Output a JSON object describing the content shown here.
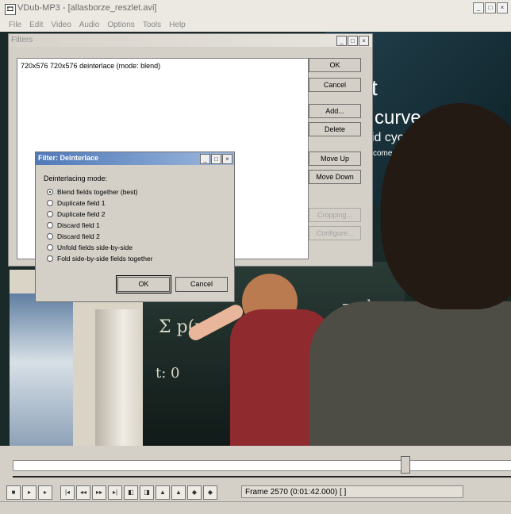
{
  "window": {
    "title": "VDub-MP3 - [allasborze_reszlet.avi]",
    "app_icon": "🎞",
    "controls": [
      "_",
      "□",
      "×"
    ]
  },
  "menu": [
    "File",
    "Edit",
    "Video",
    "Audio",
    "Options",
    "Tools",
    "Help"
  ],
  "video_overlay": {
    "slide_texts": [
      "t",
      "curve",
      "id cycle.",
      "come to life"
    ]
  },
  "filters_dialog": {
    "title": "Filters",
    "controls": [
      "_",
      "□",
      "×"
    ],
    "filter_item": "720x576 720x576 deinterlace (mode: blend)",
    "buttons": {
      "ok": "OK",
      "cancel": "Cancel",
      "add": "Add...",
      "delete": "Delete",
      "move_up": "Move Up",
      "move_down": "Move Down",
      "cropping": "Cropping...",
      "configure": "Configure..."
    }
  },
  "deinterlace_dialog": {
    "title": "Filter: Deinterlace",
    "controls": [
      "_",
      "□",
      "×"
    ],
    "group_label": "Deinterlacing mode:",
    "options": [
      {
        "label": "Blend fields together (best)",
        "checked": true
      },
      {
        "label": "Duplicate field 1",
        "checked": false
      },
      {
        "label": "Duplicate field 2",
        "checked": false
      },
      {
        "label": "Discard field 1",
        "checked": false
      },
      {
        "label": "Discard field 2",
        "checked": false
      },
      {
        "label": "Unfold fields side-by-side",
        "checked": false
      },
      {
        "label": "Fold side-by-side fields together",
        "checked": false
      }
    ],
    "ok": "OK",
    "cancel": "Cancel"
  },
  "timeline": {
    "frame_text": "Frame 2570 (0:01:42.000) [ ]",
    "toolbar_icons": [
      "stop-icon",
      "play-input-icon",
      "play-output-icon",
      "go-start-icon",
      "prev-key-icon",
      "next-key-icon",
      "go-end-icon",
      "scene-prev-icon",
      "scene-next-icon",
      "mark-in-icon",
      "mark-out-icon",
      "mark-sel-icon",
      "mark-clear-icon"
    ],
    "toolbar_glyphs": [
      "■",
      "▸",
      "▸",
      "|◂",
      "◂◂",
      "▸▸",
      "▸|",
      "◧",
      "◨",
      "▲",
      "▲",
      "◆",
      "◆"
    ]
  }
}
